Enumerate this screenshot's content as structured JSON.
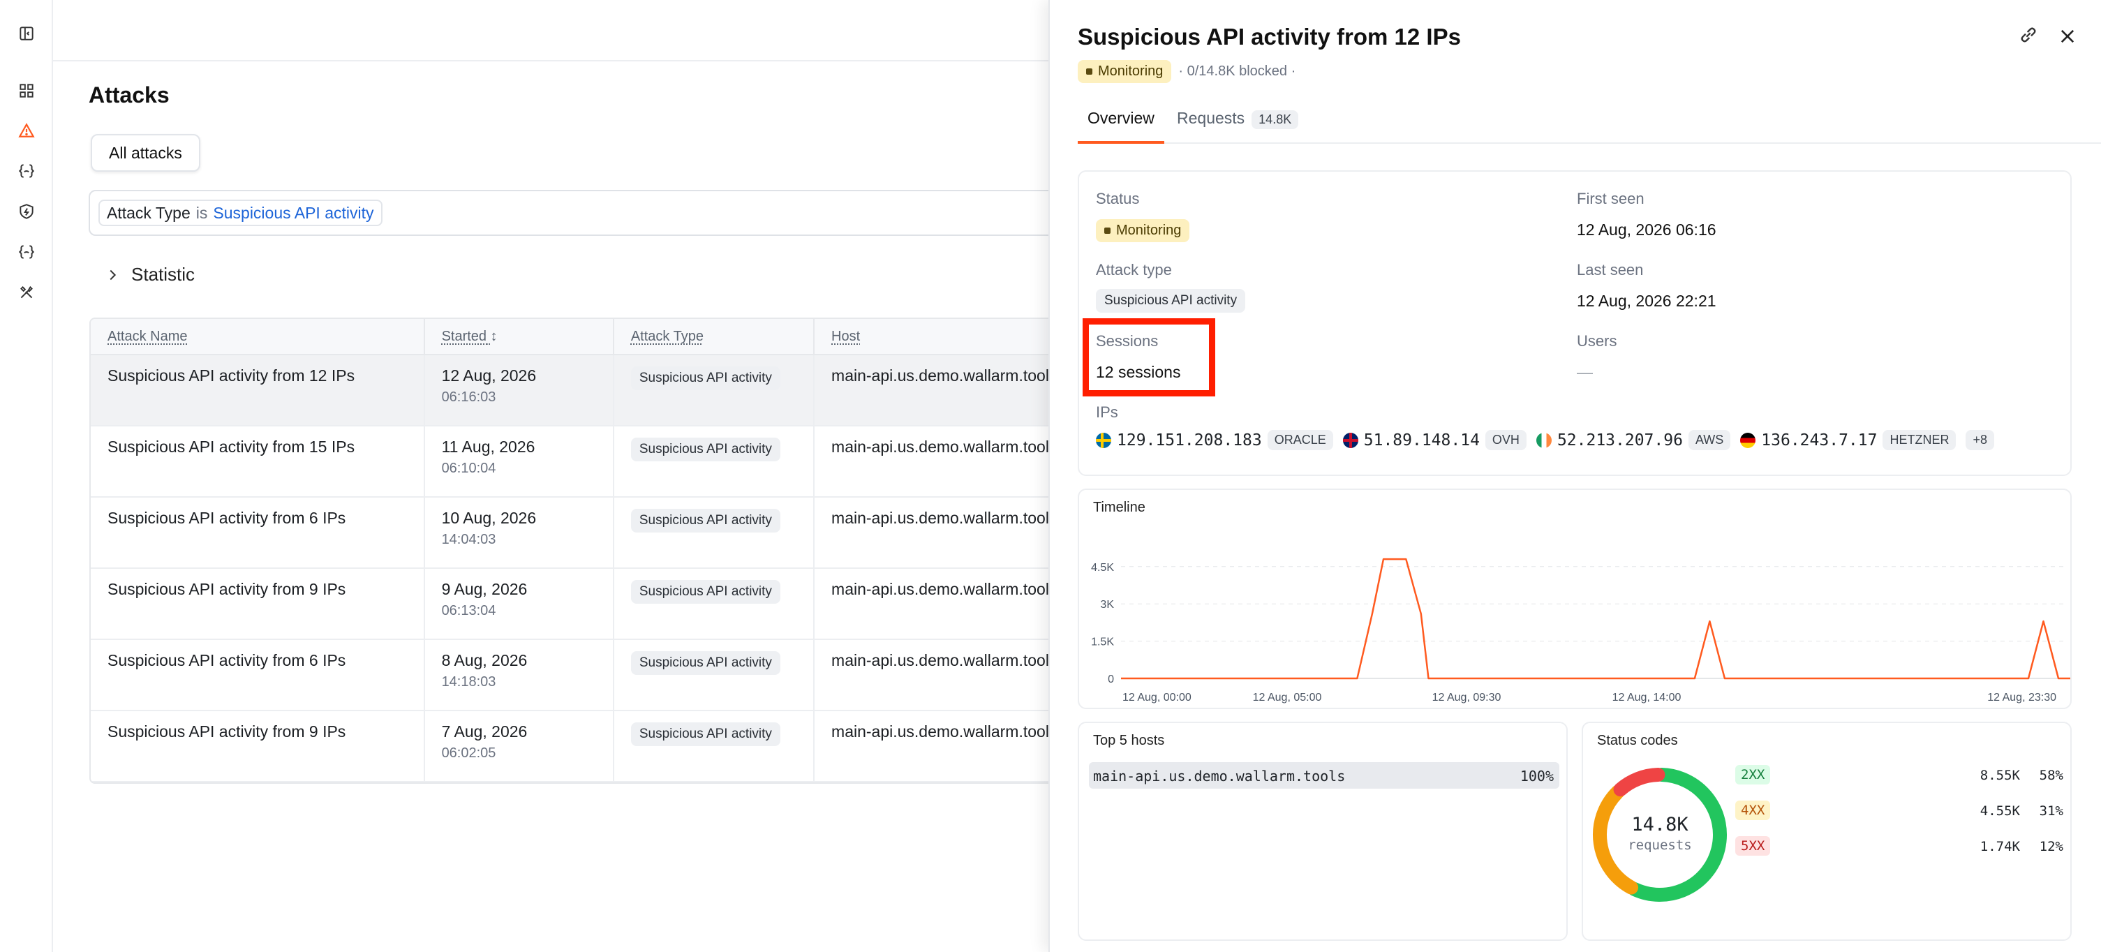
{
  "page": {
    "title": "Attacks"
  },
  "tabs": {
    "all": "All attacks"
  },
  "filter": {
    "field": "Attack Type",
    "operator": "is",
    "value": "Suspicious API activity"
  },
  "statistic": {
    "label": "Statistic"
  },
  "table": {
    "headers": [
      "Attack Name",
      "Started",
      "Attack Type",
      "Host"
    ],
    "rows": [
      {
        "name": "Suspicious API activity from 12 IPs",
        "date": "12 Aug, 2026",
        "time": "06:16:03",
        "type": "Suspicious API activity",
        "host": "main-api.us.demo.wallarm.tools"
      },
      {
        "name": "Suspicious API activity from 15 IPs",
        "date": "11 Aug, 2026",
        "time": "06:10:04",
        "type": "Suspicious API activity",
        "host": "main-api.us.demo.wallarm.tools"
      },
      {
        "name": "Suspicious API activity from 6 IPs",
        "date": "10 Aug, 2026",
        "time": "14:04:03",
        "type": "Suspicious API activity",
        "host": "main-api.us.demo.wallarm.tools"
      },
      {
        "name": "Suspicious API activity from 9 IPs",
        "date": "9 Aug, 2026",
        "time": "06:13:04",
        "type": "Suspicious API activity",
        "host": "main-api.us.demo.wallarm.tools"
      },
      {
        "name": "Suspicious API activity from 6 IPs",
        "date": "8 Aug, 2026",
        "time": "14:18:03",
        "type": "Suspicious API activity",
        "host": "main-api.us.demo.wallarm.tools"
      },
      {
        "name": "Suspicious API activity from 9 IPs",
        "date": "7 Aug, 2026",
        "time": "06:02:05",
        "type": "Suspicious API activity",
        "host": "main-api.us.demo.wallarm.tools"
      }
    ]
  },
  "drawer": {
    "title": "Suspicious API activity from 12 IPs",
    "status": "Monitoring",
    "blocked": "· 0/14.8K blocked ·",
    "tabs": {
      "overview": "Overview",
      "requests": "Requests",
      "requests_count": "14.8K"
    },
    "fields": {
      "status_label": "Status",
      "status_value": "Monitoring",
      "first_seen_label": "First seen",
      "first_seen_value": "12 Aug, 2026 06:16",
      "attack_type_label": "Attack type",
      "attack_type_value": "Suspicious API activity",
      "last_seen_label": "Last seen",
      "last_seen_value": "12 Aug, 2026 22:21",
      "sessions_label": "Sessions",
      "sessions_value": "12 sessions",
      "users_label": "Users",
      "users_value": "—",
      "ips_label": "IPs"
    },
    "ips": [
      {
        "ip": "129.151.208.183",
        "provider": "ORACLE",
        "flag": "se"
      },
      {
        "ip": "51.89.148.14",
        "provider": "OVH",
        "flag": "gb"
      },
      {
        "ip": "52.213.207.96",
        "provider": "AWS",
        "flag": "ie"
      },
      {
        "ip": "136.243.7.17",
        "provider": "HETZNER",
        "flag": "de"
      }
    ],
    "ips_more": "+8",
    "timeline": {
      "title": "Timeline"
    },
    "hosts": {
      "title": "Top 5 hosts",
      "items": [
        {
          "name": "main-api.us.demo.wallarm.tools",
          "pct": "100%"
        }
      ]
    },
    "codes": {
      "title": "Status codes",
      "total": "14.8K",
      "total_label": "requests",
      "items": [
        {
          "code": "2XX",
          "count": "8.55K",
          "pct": "58%",
          "color": "#22c55e",
          "bg": "#dcfce7",
          "fg": "#15803d",
          "share": 0.58
        },
        {
          "code": "4XX",
          "count": "4.55K",
          "pct": "31%",
          "color": "#f59e0b",
          "bg": "#fef3c7",
          "fg": "#b45309",
          "share": 0.31
        },
        {
          "code": "5XX",
          "count": "1.74K",
          "pct": "12%",
          "color": "#ef4444",
          "bg": "#fee2e2",
          "fg": "#b91c1c",
          "share": 0.12
        }
      ]
    }
  },
  "chart_data": {
    "type": "line",
    "title": "Timeline",
    "x_ticks": [
      "12 Aug, 00:00",
      "12 Aug, 05:00",
      "12 Aug, 09:30",
      "12 Aug, 14:00",
      "12 Aug, 23:30"
    ],
    "y_ticks": [
      "0",
      "1.5K",
      "3K",
      "4.5K"
    ],
    "ylim": [
      0,
      5000
    ],
    "xlim_hours": [
      0,
      24
    ],
    "series": [
      {
        "color": "#ff5a1f",
        "x": [
          0,
          6.3,
          6.7,
          7.0,
          7.6,
          8.0,
          8.2,
          8.7,
          15.3,
          15.7,
          16.1,
          24.2,
          24.6,
          25.0,
          25.4
        ],
        "y": [
          0,
          0,
          2600,
          4800,
          4800,
          2600,
          0,
          0,
          0,
          2300,
          0,
          0,
          2300,
          0,
          0
        ]
      }
    ]
  }
}
